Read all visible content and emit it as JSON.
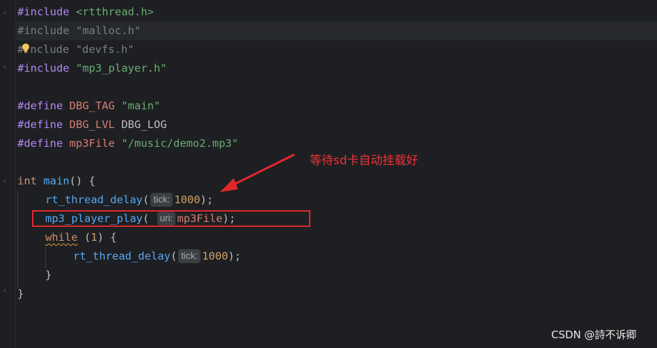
{
  "editor": {
    "lines": {
      "l1": {
        "directive": "#include",
        "arg": "<rtthread.h>"
      },
      "l2": {
        "directive": "#include",
        "arg": "\"malloc.h\""
      },
      "l3": {
        "directive_head": "#",
        "directive_tail": "nclude",
        "arg": "\"devfs.h\""
      },
      "l4": {
        "directive": "#include",
        "arg": "\"mp3_player.h\""
      },
      "l6": {
        "directive": "#define",
        "name": "DBG_TAG",
        "value": "\"main\""
      },
      "l7": {
        "directive": "#define",
        "name": "DBG_LVL",
        "value": "DBG_LOG"
      },
      "l8": {
        "directive": "#define",
        "name": "mp3File",
        "value": "\"/music/demo2.mp3\""
      },
      "l10": {
        "type": "int",
        "name": "main",
        "rest": "() {"
      },
      "l11": {
        "fn": "rt_thread_delay",
        "open": "(",
        "hint": "tick:",
        "arg": "1000",
        "close": ");"
      },
      "l12": {
        "fn": "mp3_player_play",
        "open": "(",
        "hint": "uri:",
        "arg": "mp3File",
        "close": ");"
      },
      "l13": {
        "kw": "while",
        "open": " (",
        "arg": "1",
        "close": ") {"
      },
      "l14": {
        "fn": "rt_thread_delay",
        "open": "(",
        "hint": "tick:",
        "arg": "1000",
        "close": ");"
      },
      "l15": {
        "text": "}"
      },
      "l16": {
        "text": "}"
      }
    }
  },
  "annotation": {
    "text": "等待sd卡自动挂载好"
  },
  "watermark": {
    "text": "CSDN @詩不诉卿"
  },
  "colors": {
    "background": "#1e1f22",
    "directive": "#b189f5",
    "keyword": "#cf8e6d",
    "string": "#6aab73",
    "macro": "#d67e73",
    "function": "#56a8f5",
    "annotation_red": "#e0282c"
  },
  "icons": {
    "bulb": "lightbulb-icon",
    "arrow": "red-arrow"
  }
}
